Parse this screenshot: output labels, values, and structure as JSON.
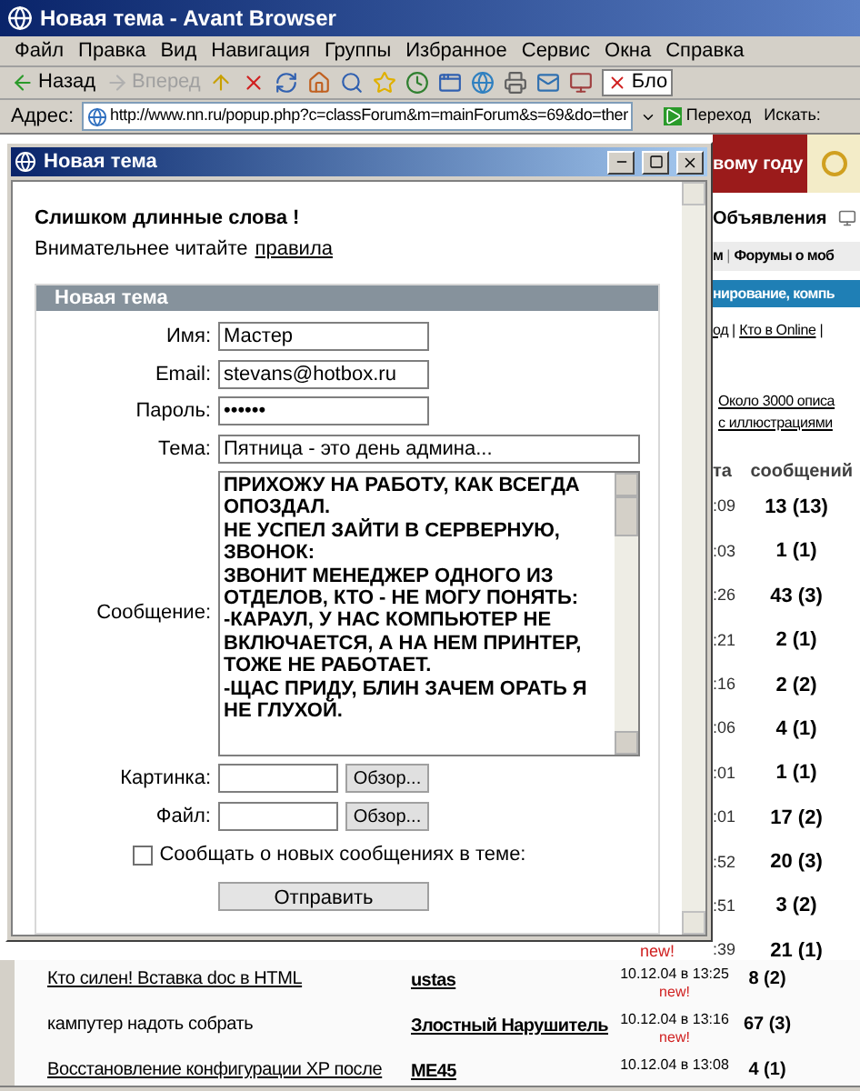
{
  "browser": {
    "title": "Новая тема - Avant Browser",
    "menu": [
      "Файл",
      "Правка",
      "Вид",
      "Навигация",
      "Группы",
      "Избранное",
      "Сервис",
      "Окна",
      "Справка"
    ],
    "nav_buttons": [
      {
        "label": "Назад",
        "disabled": false
      },
      {
        "label": "Вперед",
        "disabled": true
      }
    ],
    "tab_label": "Бло",
    "address": {
      "label": "Адрес:",
      "value": "http://www.nn.ru/popup.php?c=classForum&m=mainForum&s=69&do=ther",
      "go": "Переход",
      "search_label": "Искать:"
    }
  },
  "page": {
    "banner": "вому году",
    "ads": "Объявления",
    "nav": [
      {
        "kind": "text",
        "text": "м"
      },
      {
        "kind": "sep",
        "text": "|"
      },
      {
        "kind": "text",
        "text": "Форумы о моб"
      }
    ],
    "section": "нирование, компь",
    "links": [
      {
        "kind": "link",
        "text": "од"
      },
      {
        "kind": "sep",
        "text": "|"
      },
      {
        "kind": "link",
        "text": "Кто в Online"
      },
      {
        "kind": "sep",
        "text": "|"
      }
    ],
    "promo": [
      "Около 3000 описа",
      "с иллюстрациями"
    ],
    "header": [
      "та",
      "сообщений"
    ],
    "rows": [
      {
        "time": ":09",
        "count": "13 (13)"
      },
      {
        "time": ":03",
        "count": "1 (1)"
      },
      {
        "time": ":26",
        "count": "43 (3)"
      },
      {
        "time": ":21",
        "count": "2 (1)"
      },
      {
        "time": ":16",
        "count": "2 (2)"
      },
      {
        "time": ":06",
        "count": "4 (1)"
      },
      {
        "time": ":01",
        "count": "1 (1)"
      },
      {
        "time": ":01",
        "count": "17 (2)"
      },
      {
        "time": ":52",
        "count": "20 (3)"
      },
      {
        "time": ":51",
        "count": "3 (2)"
      },
      {
        "time": ":39",
        "count": "21 (1)"
      }
    ],
    "top_note": "new!",
    "topics": [
      {
        "title": "Кто силен! Вставка doc в HTML",
        "kind": "link",
        "author": "ustas",
        "date": "10.12.04 в 13:25",
        "new": "new!",
        "count": "8 (2)"
      },
      {
        "title": "кампутер надоть собрать",
        "kind": "plain",
        "author": "Злостный Нарушитель",
        "date": "10.12.04 в 13:16",
        "new": "new!",
        "count": "67 (3)"
      },
      {
        "title": "Восстановление конфигурации XP после",
        "kind": "link",
        "author": "ME45",
        "date": "10.12.04 в 13:08",
        "count": "4 (1)"
      }
    ]
  },
  "popup": {
    "title": "Новая тема",
    "error": "Слишком длинные слова !",
    "hint": "Внимательнее читайте",
    "hint_link": "правила",
    "panel_title": "Новая тема",
    "fields": [
      {
        "label": "Имя:",
        "value": "Мастер",
        "kind": "short"
      },
      {
        "label": "Email:",
        "value": "stevans@hotbox.ru",
        "kind": "short"
      },
      {
        "label": "Пароль:",
        "value": "••••••",
        "kind": "short"
      },
      {
        "label": "Тема:",
        "value": "Пятница - это день админа...",
        "kind": "long"
      }
    ],
    "message": {
      "label": "Сообщение:",
      "paragraphs": [
        "ПРИХОЖУ НА РАБОТУ, КАК ВСЕГДА ОПОЗДАЛ.",
        "НЕ УСПЕЛ ЗАЙТИ В СЕРВЕРНУЮ, ЗВОНОК:",
        "ЗВОНИТ МЕНЕДЖЕР ОДНОГО ИЗ ОТДЕЛОВ, КТО - НЕ МОГУ ПОНЯТЬ:",
        "-КАРАУЛ, У НАС КОМПЬЮТЕР НЕ ВКЛЮЧАЕТСЯ, А НА НЕМ ПРИНТЕР, ТОЖЕ НЕ РАБОТАЕТ.",
        "-ЩАС ПРИДУ, БЛИН ЗАЧЕМ ОРАТЬ Я НЕ ГЛУХОЙ."
      ]
    },
    "uploads": [
      {
        "label": "Картинка:",
        "button": "Обзор..."
      },
      {
        "label": "Файл:",
        "button": "Обзор..."
      }
    ],
    "notify": {
      "label": "Сообщать о новых сообщениях в теме:",
      "checked": false
    },
    "submit": "Отправить"
  }
}
